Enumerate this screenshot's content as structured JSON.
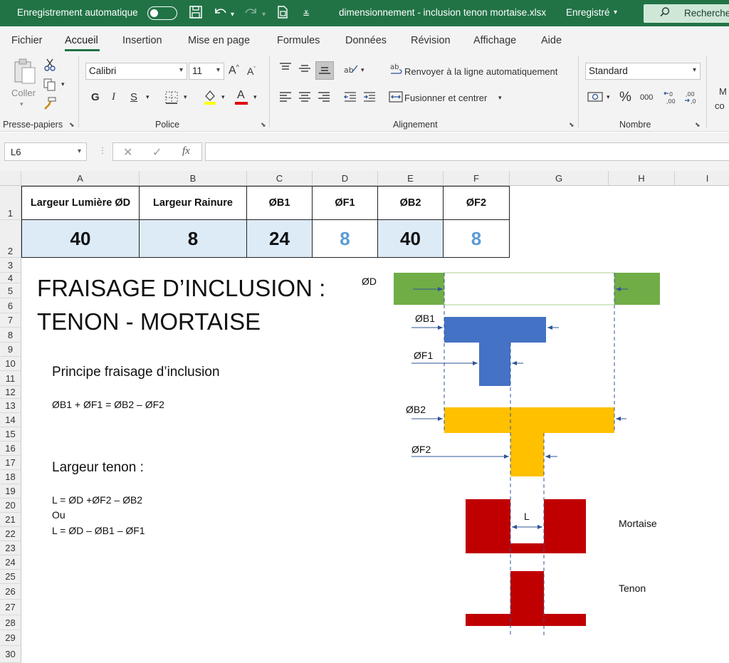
{
  "titlebar": {
    "autosave_label": "Enregistrement automatique",
    "filename": "dimensionnement - inclusion tenon mortaise.xlsx",
    "save_status": "Enregistré",
    "search_placeholder": "Recherche"
  },
  "tabs": [
    "Fichier",
    "Accueil",
    "Insertion",
    "Mise en page",
    "Formules",
    "Données",
    "Révision",
    "Affichage",
    "Aide"
  ],
  "active_tab": "Accueil",
  "ribbon": {
    "clipboard": {
      "paste_label": "Coller",
      "group_label": "Presse-papiers"
    },
    "font": {
      "name": "Calibri",
      "size": "11",
      "bold": "G",
      "italic": "I",
      "underline": "S",
      "grow": "A^",
      "shrink": "A^",
      "color_letter": "A",
      "group_label": "Police"
    },
    "alignment": {
      "wrap_label": "Renvoyer à la ligne automatiquement",
      "merge_label": "Fusionner et centrer",
      "group_label": "Alignement"
    },
    "number": {
      "format": "Standard",
      "percent": "%",
      "thousands": "000",
      "group_label": "Nombre"
    },
    "overflow_label_1": "M",
    "overflow_label_2": "co"
  },
  "formula_bar": {
    "cell_ref": "L6",
    "formula": ""
  },
  "columns": [
    "A",
    "B",
    "C",
    "D",
    "E",
    "F",
    "G",
    "H",
    "I"
  ],
  "rows": [
    "1",
    "2",
    "3",
    "4",
    "5",
    "6",
    "7",
    "8",
    "9",
    "10",
    "11",
    "12",
    "13",
    "14",
    "15",
    "16",
    "17",
    "18",
    "19",
    "20",
    "21",
    "22",
    "23",
    "24",
    "25",
    "26",
    "27",
    "28",
    "29",
    "30"
  ],
  "table": {
    "headers": [
      "Largeur Lumière ØD",
      "Largeur Rainure",
      "ØB1",
      "ØF1",
      "ØB2",
      "ØF2"
    ],
    "values": [
      "40",
      "8",
      "24",
      "8",
      "40",
      "8"
    ]
  },
  "sheet": {
    "title_line1": "FRAISAGE D’INCLUSION :",
    "title_line2": "TENON - MORTAISE",
    "principle_heading": "Principe fraisage d’inclusion",
    "principle_formula": "ØB1 + ØF1 = ØB2 – ØF2",
    "tenon_heading": "Largeur tenon :",
    "tenon_formula1": "L = ØD +ØF2 – ØB2",
    "tenon_or": "Ou",
    "tenon_formula2": "L = ØD – ØB1 – ØF1"
  },
  "diagram": {
    "label_d": "ØD",
    "label_b1": "ØB1",
    "label_f1": "ØF1",
    "label_b2": "ØB2",
    "label_f2": "ØF2",
    "label_l": "L",
    "label_mortaise": "Mortaise",
    "label_tenon": "Tenon",
    "colors": {
      "green": "#70ad47",
      "blue": "#4472c4",
      "yellow": "#ffc000",
      "red": "#c00000",
      "line": "#2f5597"
    }
  },
  "colors": {
    "excel_green": "#217346",
    "header_blue_bg": "#ddebf7",
    "value_blue": "#5b9bd5"
  }
}
